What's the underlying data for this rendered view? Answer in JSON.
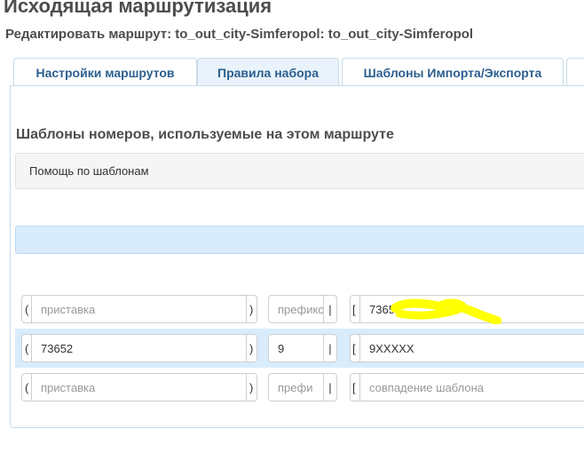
{
  "header": {
    "title": "Исходящая маршрутизация",
    "subtitle": "Редактировать маршрут: to_out_city-Simferopol: to_out_city-Simferopol"
  },
  "tabs": [
    {
      "label": "Настройки маршрутов",
      "active": false
    },
    {
      "label": "Правила набора",
      "active": true
    },
    {
      "label": "Шаблоны Импорта/Экспорта",
      "active": false
    }
  ],
  "section": {
    "title": "Шаблоны номеров, используемые на этом маршруте",
    "help_label": "Помощь по шаблонам"
  },
  "rows": [
    {
      "prepend": {
        "value": "",
        "placeholder": "приставка"
      },
      "prefix": {
        "value": "",
        "placeholder": "префикс"
      },
      "match": {
        "value": "7365",
        "placeholder": ""
      },
      "highlighted": false
    },
    {
      "prepend": {
        "value": "73652",
        "placeholder": ""
      },
      "prefix": {
        "value": "9",
        "placeholder": ""
      },
      "match": {
        "value": "9XXXXX",
        "placeholder": ""
      },
      "highlighted": true
    },
    {
      "prepend": {
        "value": "",
        "placeholder": "приставка"
      },
      "prefix": {
        "value": "",
        "placeholder": "префи"
      },
      "match": {
        "value": "",
        "placeholder": "совпадение шаблона"
      },
      "highlighted": false
    }
  ],
  "symbols": {
    "open_paren": "(",
    "close_paren": ")",
    "pipe": "|",
    "open_bracket": "["
  },
  "colors": {
    "accent": "#2c5f8f",
    "row_highlight": "#d9ecfb",
    "marker": "#ffff00"
  }
}
